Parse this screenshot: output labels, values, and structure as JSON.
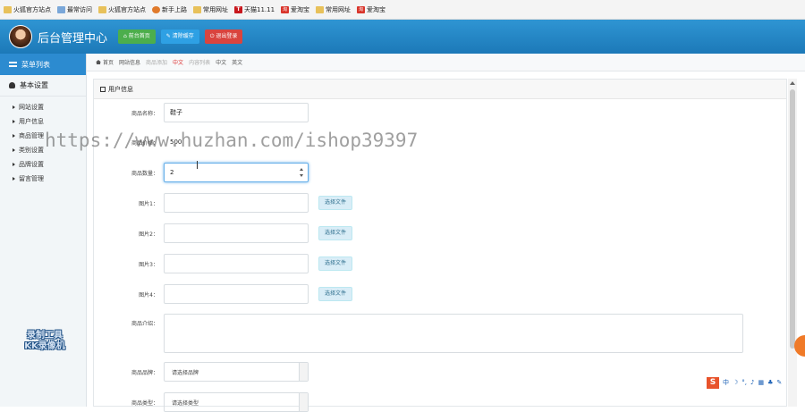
{
  "bookmarks": [
    {
      "label": "火狐官方站点",
      "icon": "folder-icon"
    },
    {
      "label": "最常访问",
      "icon": "globe-icon"
    },
    {
      "label": "火狐官方站点",
      "icon": "folder-icon"
    },
    {
      "label": "新手上路",
      "icon": "firefox-icon"
    },
    {
      "label": "常用网址",
      "icon": "folder-icon"
    },
    {
      "label": "天猫11.11",
      "icon": "tmall-icon",
      "badge": "T"
    },
    {
      "label": "爱淘宝",
      "icon": "aitaobao-icon",
      "badge": "淘"
    },
    {
      "label": "常用网址",
      "icon": "folder-icon"
    },
    {
      "label": "爱淘宝",
      "icon": "aitaobao-icon",
      "badge": "淘"
    }
  ],
  "header": {
    "title": "后台管理中心",
    "buttons": [
      {
        "label": "前台首页",
        "color": "#4cae4c"
      },
      {
        "label": "清除缓存",
        "color": "#2ea0e4"
      },
      {
        "label": "退出登录",
        "color": "#d9443e"
      }
    ]
  },
  "sidebar": {
    "heading": "菜单列表",
    "group": "基本设置",
    "items": [
      {
        "label": "网站设置"
      },
      {
        "label": "用户信息"
      },
      {
        "label": "商品管理"
      },
      {
        "label": "类别设置"
      },
      {
        "label": "品牌设置"
      },
      {
        "label": "留言管理"
      }
    ]
  },
  "breadcrumb": {
    "home": "首页",
    "items": [
      "网站信息",
      "商品添加",
      "中文",
      "内容列表",
      "中文",
      "英文"
    ]
  },
  "panel": {
    "title": "用户信息"
  },
  "form": {
    "name_label": "商品名称：",
    "name_value": "鞋子",
    "price_label": "商品价格：",
    "price_value": "500",
    "qty_label": "商品数量：",
    "qty_value": "2",
    "pic1_label": "图片1：",
    "pic2_label": "图片2：",
    "pic3_label": "图片3：",
    "pic4_label": "图片4：",
    "file_button": "选择文件",
    "intro_label": "商品介绍：",
    "brand_label": "商品品牌：",
    "brand_value": "请选择品牌",
    "type_label": "商品类型：",
    "type_value": "请选择类型"
  },
  "overlays": {
    "url_watermark": "https://www.huzhan.com/ishop39397",
    "recorder_line1": "录制工具",
    "recorder_line2": "KK录像机",
    "ime_logo": "S",
    "ime_lang": "中"
  },
  "colors": {
    "header_blue": "#1c79b8",
    "sidebar_head": "#2c8bd0",
    "accent_orange": "#f07a28"
  }
}
